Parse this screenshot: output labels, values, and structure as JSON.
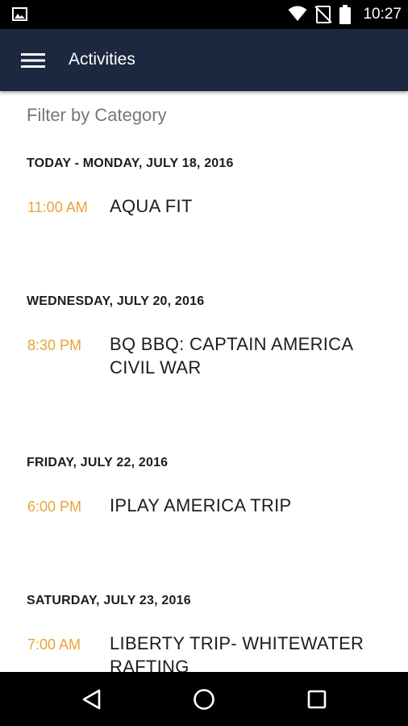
{
  "status_bar": {
    "time": "10:27",
    "icons": [
      "image-notification-icon",
      "wifi-icon",
      "no-signal-icon",
      "battery-icon"
    ]
  },
  "app_bar": {
    "title": "Activities",
    "menu_icon": "hamburger-menu-icon"
  },
  "filter": {
    "label": "Filter by Category"
  },
  "colors": {
    "app_bar_bg": "#1c2840",
    "time_accent": "#e8a33a",
    "text_dark": "#1c1c24",
    "filter_text": "#777777"
  },
  "days": [
    {
      "header": "TODAY - MONDAY, JULY 18, 2016",
      "events": [
        {
          "time": "11:00 AM",
          "name": "AQUA FIT"
        }
      ]
    },
    {
      "header": "WEDNESDAY, JULY 20, 2016",
      "events": [
        {
          "time": "8:30 PM",
          "name": "BQ BBQ: CAPTAIN AMERICA CIVIL WAR"
        }
      ]
    },
    {
      "header": "FRIDAY, JULY 22, 2016",
      "events": [
        {
          "time": "6:00 PM",
          "name": "IPLAY AMERICA TRIP"
        }
      ]
    },
    {
      "header": "SATURDAY, JULY 23, 2016",
      "events": [
        {
          "time": "7:00 AM",
          "name": "LIBERTY TRIP- WHITEWATER RAFTING"
        }
      ]
    }
  ],
  "nav_bar": {
    "buttons": [
      "back-icon",
      "home-icon",
      "recents-icon"
    ]
  }
}
